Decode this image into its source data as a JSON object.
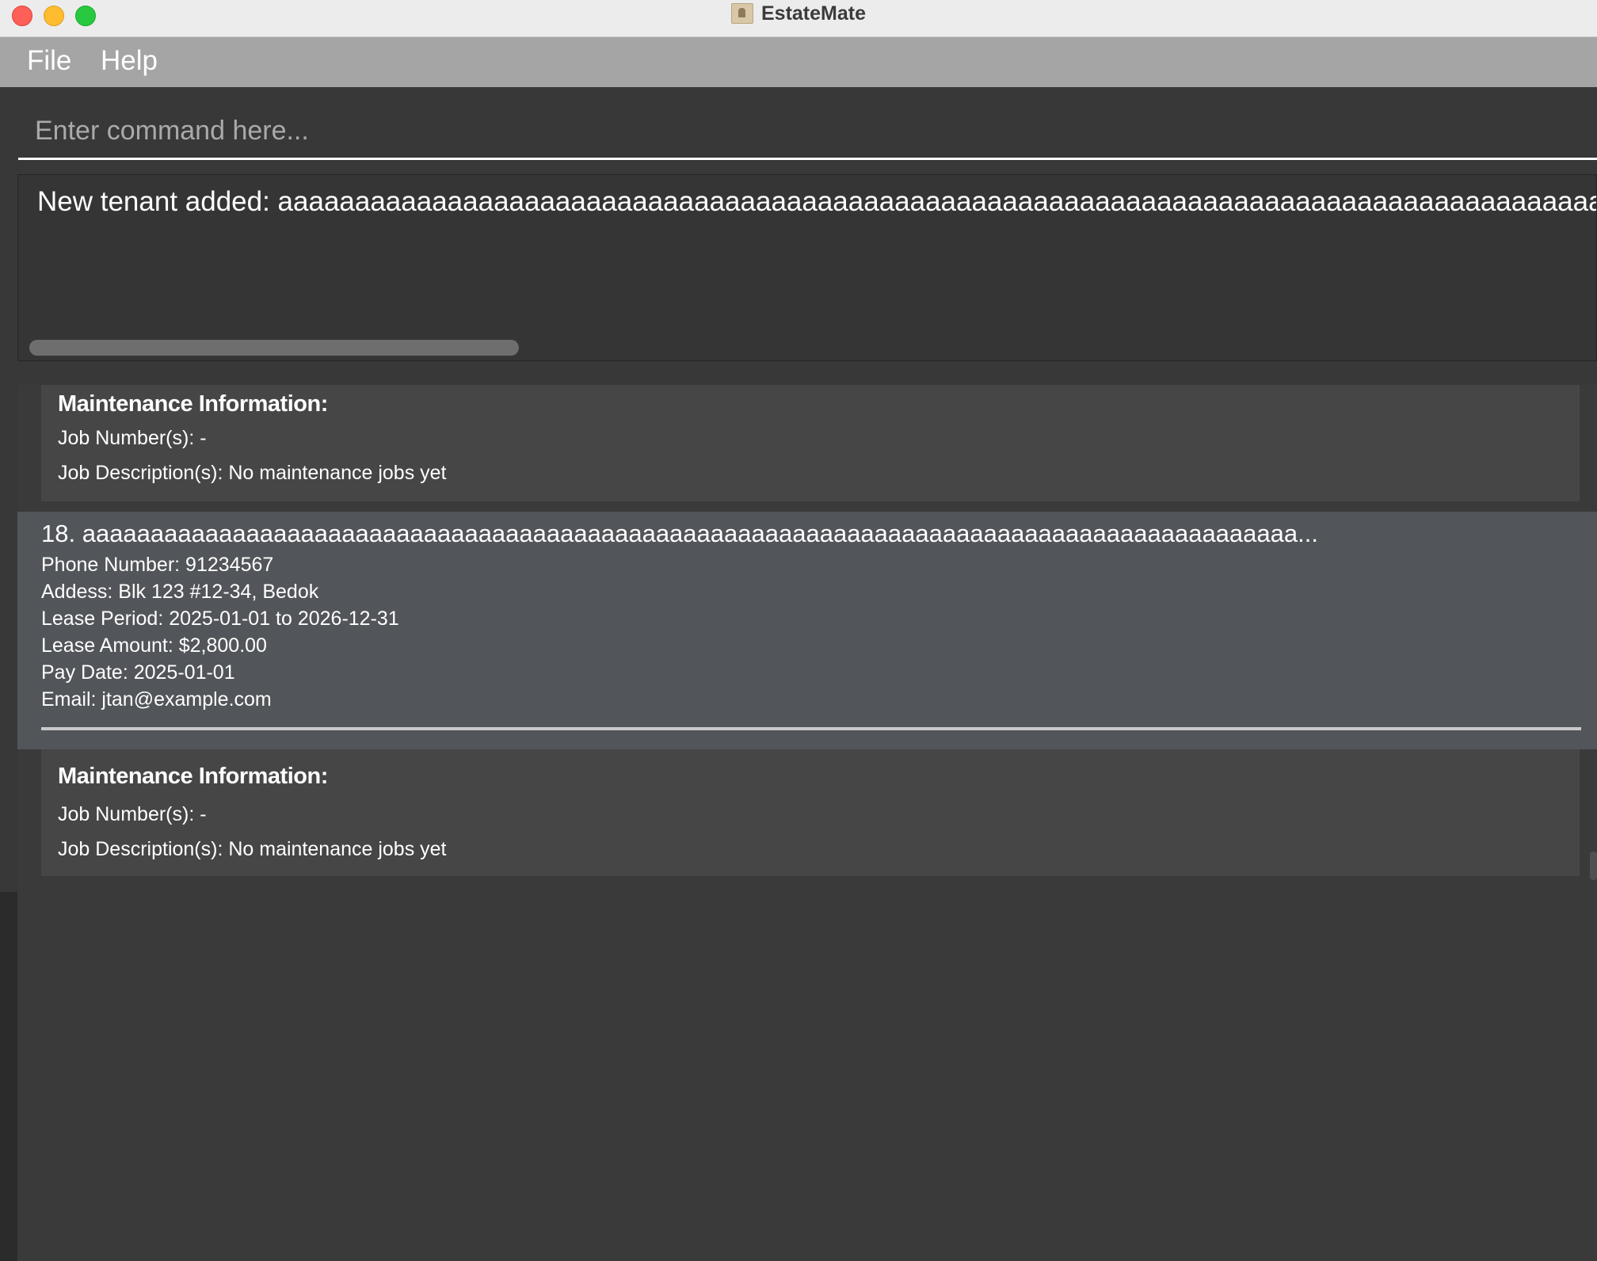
{
  "window": {
    "title": "EstateMate"
  },
  "menu": {
    "file": "File",
    "help": "Help"
  },
  "command": {
    "placeholder": "Enter command here...",
    "value": ""
  },
  "result": {
    "text": "New tenant added: aaaaaaaaaaaaaaaaaaaaaaaaaaaaaaaaaaaaaaaaaaaaaaaaaaaaaaaaaaaaaaaaaaaaaaaaaaaaaaaaaaaaaaaaaaaaa"
  },
  "maintenance_top": {
    "title": "Maintenance Information:",
    "job_numbers": "Job Number(s): -",
    "job_descriptions": "Job Description(s): No maintenance jobs yet"
  },
  "tenant": {
    "name": "18. aaaaaaaaaaaaaaaaaaaaaaaaaaaaaaaaaaaaaaaaaaaaaaaaaaaaaaaaaaaaaaaaaaaaaaaaaaaaaaaaaaaaaaaaa...",
    "phone": "Phone Number:  91234567",
    "address": "Addess:  Blk 123 #12-34, Bedok",
    "lease_period": "Lease Period: 2025-01-01 to 2026-12-31",
    "lease_amount": "Lease Amount: $2,800.00",
    "pay_date": "Pay Date: 2025-01-01",
    "email": "Email: jtan@example.com"
  },
  "maintenance_bottom": {
    "title": "Maintenance Information:",
    "job_numbers": "Job Number(s): -",
    "job_descriptions": "Job Description(s): No maintenance jobs yet"
  },
  "icons": {
    "app": "estatemate-app-icon"
  }
}
